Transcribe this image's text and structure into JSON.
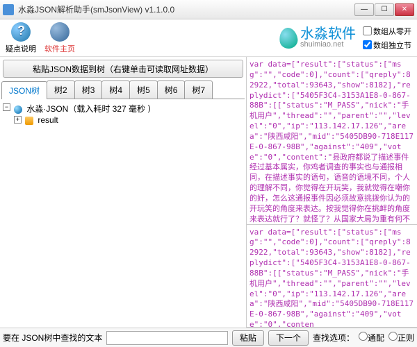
{
  "window": {
    "title": "水淼JSON解析助手(smJsonView) v1.1.0.0"
  },
  "toolbar": {
    "help_label": "疑点说明",
    "home_label": "软件主页"
  },
  "brand": {
    "name": "水淼软件",
    "url": "shuimiao.net"
  },
  "options": {
    "opt1_label": "数组从零开",
    "opt2_label": "数组独立节",
    "opt1_checked": false,
    "opt2_checked": true
  },
  "paste_button": "粘贴JSON数据到树（右键单击可读取网址数据）",
  "tabs": [
    "JSON树",
    "树2",
    "树3",
    "树4",
    "树5",
    "树6",
    "树7"
  ],
  "tree": {
    "root_label": "水淼·JSON（载入耗时 327 毫秒 ）",
    "child1": "result"
  },
  "raw1": "var data=[\"result\":[\"status\":[\"msg\":\"\",\"code\":0],\"count\":[\"qreply\":82922,\"total\":93643,\"show\":8182],\"replydict\":[\"5405F3C4-3153A1E8-0-867-88B\":[[\"status\":\"M_PASS\",\"nick\":\"手机用户\",\"thread\":\"\",\"parent\":\"\",\"level\":\"0\",\"ip\":\"113.142.17.126\",\"area\":\"陕西咸阳\",\"mid\":\"5405DB90-718E117E-0-867-98B\",\"against\":\"409\",\"vote\":\"0\",\"content\":\"县政府都说了描述事件经过基本属实，你鸡者调查的事实也与通报相同，在描述事实的语句，语音的语境不同，个人的理解不同，你觉得在开玩笑，我就觉得在嘲你的奸，怎么这通报事件因必须故意挑拨你认为的开玩笑的角度来表达。按我觉得你在挑衅的角度来表达就行了？就怪了？从国家大局为重有何不可？这种小事件情况，内部消化可能更实，主要搞得满城风雨啦，让外国人看笑话，让某分们集体高潮，让国家处于骂骂的负面情绪中，亲者痛，仇者快，这老师确\"",
  "raw2": "var data=[\"result\":[\"status\":[\"msg\":\"\",\"code\":0],\"count\":[\"qreply\":82922,\"total\":93643,\"show\":8182],\"replydict\":[\"5405F3C4-3153A1E8-0-867-88B\":[[\"status\":\"M_PASS\",\"nick\":\"手机用户\",\"thread\":\"\",\"parent\":\"\",\"level\":\"0\",\"ip\":\"113.142.17.126\",\"area\":\"陕西咸阳\",\"mid\":\"5405DB90-718E117E-0-867-98B\",\"against\":\"409\",\"vote\":\"0\",\"conten",
  "bottom": {
    "search_label": "要在 JSON树中查找的文本",
    "paste_btn": "粘贴",
    "next_btn": "下一个",
    "find_label": "查找选项：",
    "radio_normal": "通配",
    "radio_regex": "正则"
  }
}
